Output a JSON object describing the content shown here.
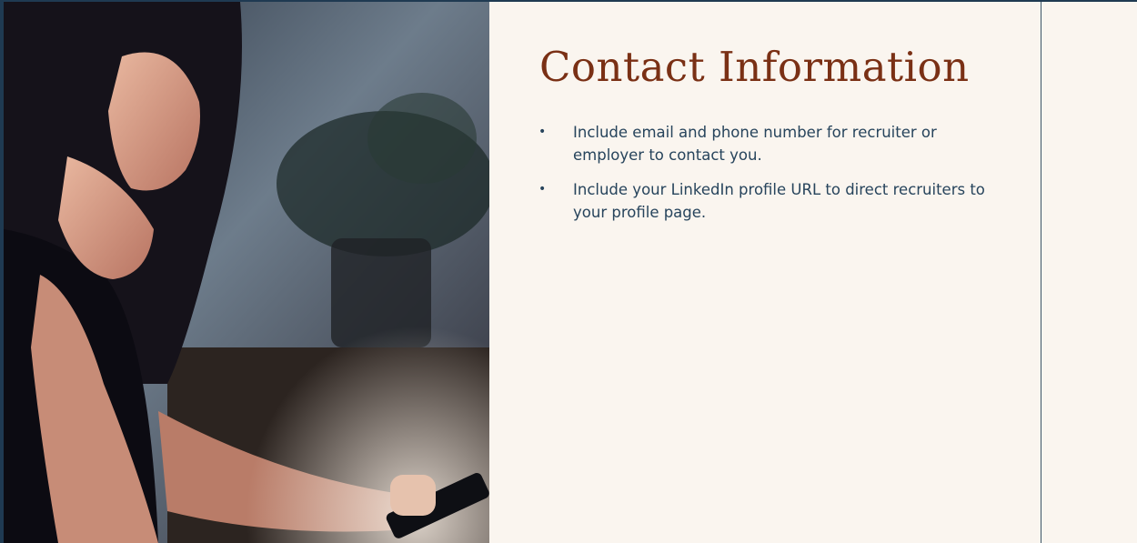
{
  "slide": {
    "title": "Contact Information",
    "bullets": [
      {
        "marker": "•",
        "text": "Include email and phone number for recruiter or employer to contact you."
      },
      {
        "marker": "•",
        "text": "Include your LinkedIn profile URL to direct recruiters to your  profile page."
      }
    ]
  },
  "colors": {
    "title": "#7a3015",
    "body_text": "#27445c",
    "background": "#faf5ef",
    "border": "#1f3a52"
  },
  "photo": {
    "subject": "woman-smiling-looking-at-phone"
  }
}
